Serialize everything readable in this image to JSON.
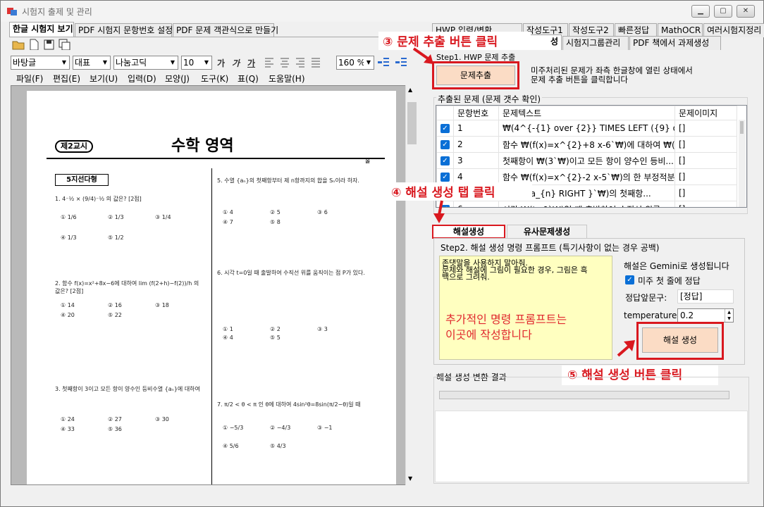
{
  "window": {
    "title": "시험지 출제 및 관리"
  },
  "left_tabs": [
    "한글 시험지 보기",
    "PDF 시험지 문항번호 설정",
    "PDF 문제 객관식으로 만들기"
  ],
  "right_tabs_row1": [
    "HWP 입력/변환",
    "작성도구1",
    "작성도구2",
    "빠른정답",
    "MathOCR",
    "여러시험지정리"
  ],
  "right_tabs_row2": [
    "성",
    "시험지그룹관리",
    "PDF 책에서 과제생성"
  ],
  "format_bar": {
    "style": "바탕글",
    "para": "대표",
    "font": "나눔고딕",
    "size": "10",
    "zoom": "160 %"
  },
  "menu": [
    "파일(F)",
    "편집(E)",
    "보기(U)",
    "입력(D)",
    "모양(J)",
    "도구(K)",
    "표(Q)",
    "도움말(H)"
  ],
  "step1": {
    "title": "Step1. HWP 문제 추출",
    "button": "문제추출",
    "desc_line1": "미주처리된 문제가 좌측 한글창에 열린 상태에서",
    "desc_line2": "문제 추출 버튼을 클릭합니다"
  },
  "extracted": {
    "title": "추출된 문제 (문제 갯수 확인)",
    "columns": [
      "문항번호",
      "문제텍스트",
      "문제이미지"
    ],
    "rows": [
      {
        "no": "1",
        "text": "₩(4^{-{1} over {2}} TIMES LEFT ({9} ove...",
        "img": "[]"
      },
      {
        "no": "2",
        "text": "함수 ₩(f(x)=x^{2}+8 x-6`₩)에 대하여 ₩(li...",
        "img": "[]"
      },
      {
        "no": "3",
        "text": "첫째항이 ₩(3`₩)이고 모든 항이 양수인 등비...",
        "img": "[]"
      },
      {
        "no": "4",
        "text": "함수 ₩(f(x)=x^{2}-2 x-5`₩)의 한 부정적분 ...",
        "img": "[]"
      },
      {
        "no": "5",
        "text": "LEFT {a_{n} RIGHT }`₩)의 첫째항...",
        "img": "[]"
      },
      {
        "no": "6",
        "text": "시각 ₩(t=0`₩)일 때 출발하여 수직선 위를",
        "img": "[]"
      }
    ]
  },
  "sub_tabs": [
    "해설생성",
    "유사문제생성"
  ],
  "step2": {
    "title": "Step2. 해설 생성 명령 프롬프트 (특기사항이 없는 경우 공백)",
    "prompt_line1": "존댓말을 사용하지 말아줘.",
    "prompt_line2": "문제와 해설에 그림이 필요한 경우, 그림은 흑",
    "prompt_line3": "백으로 그려줘.",
    "overlay_line1": "추가적인 명령 프롬프트는",
    "overlay_line2": "이곳에  작성합니다",
    "gemini_note": "해설은 Gemini로 생성됩니다",
    "checkbox_label": "미주 첫 줄에 정답",
    "answer_prefix_label": "정답앞문구:",
    "answer_prefix_value": "[정답]",
    "temperature_label": "temperature:",
    "temperature_value": "0.2",
    "generate_button": "해설 생성"
  },
  "result": {
    "title": "해설 생성 변환 결과",
    "progress": 0
  },
  "callouts": {
    "c3": "③ 문제 추출 버튼 클릭",
    "c4": "④ 해설 생성 탭 클릭",
    "c5": "⑤ 해설 생성 버튼 클릭"
  },
  "document": {
    "school_badge": "제2교시",
    "exam_title": "수학 영역",
    "section": "5지선다형",
    "q1": "1. 4⁻½ × (9/4)⁻½ 의 값은? [2점]",
    "q2": "2. 함수 f(x)=x²+8x−6에 대하여 lim (f(2+h)−f(2))/h 의 값은? [2점]",
    "q3": "3. 첫째항이 3이고 모든 항이 양수인 등비수열 {aₙ}에 대하여",
    "q5": "5. 수열 {aₙ}의 첫째항부터 제 n항까지의 합을 Sₙ이라 하자.",
    "q6": "6. 시각 t=0일 때 출발하여 수직선 위를 움직이는 점 P가 있다.",
    "q7": "7. π/2 < θ < π 인 θ에 대하여 4sin²θ=8sin(π/2−θ)일 때",
    "opts_q1": [
      "① 1/6",
      "② 1/3",
      "③ 1/4",
      "④ 1/3",
      "⑤ 1/2"
    ],
    "opts_q2": [
      "① 14",
      "② 16",
      "③ 18",
      "④ 20",
      "⑤ 22"
    ],
    "opts_q3": [
      "① 24",
      "② 27",
      "③ 30",
      "④ 33",
      "⑤ 36"
    ],
    "opts_q5": [
      "① 4",
      "② 5",
      "③ 6",
      "④ 7",
      "⑤ 8"
    ],
    "opts_q6": [
      "① 1",
      "② 2",
      "③ 3",
      "④ 4",
      "⑤ 5"
    ],
    "opts_q7": [
      "① −5/3",
      "② −4/3",
      "③ −1",
      "④ 5/6",
      "⑤ 4/3"
    ],
    "page_marker": "홀"
  }
}
